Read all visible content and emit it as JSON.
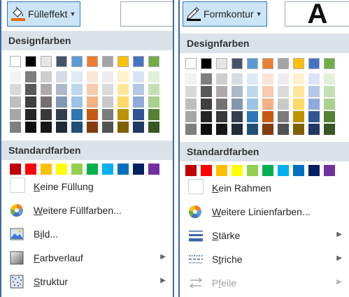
{
  "fill_menu": {
    "button_label": "Fülleffekt",
    "button_accent": "#e46c0a",
    "section_theme": "Designfarben",
    "section_standard": "Standardfarben",
    "items": [
      {
        "pre": "",
        "u": "K",
        "post": "eine Füllung",
        "icon": "no-fill-icon",
        "submenu": false,
        "disabled": false
      },
      {
        "pre": "",
        "u": "W",
        "post": "eitere Füllfarben...",
        "icon": "color-wheel-icon",
        "submenu": false,
        "disabled": false
      },
      {
        "pre": "B",
        "u": "i",
        "post": "ld...",
        "icon": "picture-icon",
        "submenu": false,
        "disabled": false
      },
      {
        "pre": "",
        "u": "F",
        "post": "arbverlauf",
        "icon": "gradient-icon",
        "submenu": true,
        "disabled": false
      },
      {
        "pre": "",
        "u": "S",
        "post": "truktur",
        "icon": "texture-icon",
        "submenu": true,
        "disabled": false
      }
    ]
  },
  "outline_menu": {
    "button_label": "Formkontur",
    "button_accent": "#000000",
    "big_letter": "A",
    "section_theme": "Designfarben",
    "section_standard": "Standardfarben",
    "items": [
      {
        "pre": "",
        "u": "K",
        "post": "ein Rahmen",
        "icon": "no-outline-icon",
        "submenu": false,
        "disabled": false
      },
      {
        "pre": "",
        "u": "W",
        "post": "eitere Linienfarben...",
        "icon": "color-wheel-icon",
        "submenu": false,
        "disabled": false
      },
      {
        "pre": "",
        "u": "S",
        "post": "tärke",
        "icon": "line-weight-icon",
        "submenu": true,
        "disabled": false
      },
      {
        "pre": "S",
        "u": "t",
        "post": "riche",
        "icon": "dashes-icon",
        "submenu": true,
        "disabled": false
      },
      {
        "pre": "P",
        "u": "f",
        "post": "eile",
        "icon": "arrows-icon",
        "submenu": true,
        "disabled": true
      }
    ]
  },
  "theme_colors": [
    [
      "#ffffff",
      "#f2f2f2",
      "#d9d9d9",
      "#bfbfbf",
      "#a6a6a6",
      "#7f7f7f"
    ],
    [
      "#000000",
      "#7f7f7f",
      "#595959",
      "#3f3f3f",
      "#262626",
      "#0d0d0d"
    ],
    [
      "#e7e6e6",
      "#d0cece",
      "#aeaaaa",
      "#757171",
      "#3a3838",
      "#171616"
    ],
    [
      "#44546a",
      "#d6dce5",
      "#adb9ca",
      "#8497b0",
      "#333f50",
      "#222a35"
    ],
    [
      "#5b9bd5",
      "#deebf7",
      "#bdd7ee",
      "#9dc3e6",
      "#2e75b6",
      "#1f4e79"
    ],
    [
      "#ed7d31",
      "#fbe5d6",
      "#f8cbad",
      "#f4b183",
      "#c55a11",
      "#843c0c"
    ],
    [
      "#a5a5a5",
      "#ededed",
      "#dbdbdb",
      "#c9c9c9",
      "#7b7b7b",
      "#525252"
    ],
    [
      "#ffc000",
      "#fff2cc",
      "#ffe699",
      "#ffd966",
      "#bf9000",
      "#7f6000"
    ],
    [
      "#4472c4",
      "#dae3f3",
      "#b4c7e7",
      "#8faadc",
      "#2f5597",
      "#203864"
    ],
    [
      "#70ad47",
      "#e2f0d9",
      "#c5e0b4",
      "#a9d18e",
      "#548235",
      "#385723"
    ]
  ],
  "standard_colors": [
    "#c00000",
    "#ff0000",
    "#ffc000",
    "#ffff00",
    "#92d050",
    "#00b050",
    "#00b0f0",
    "#0070c0",
    "#002060",
    "#7030a0"
  ],
  "chrome_colors": {
    "header_bg": "#dbe2ea",
    "pane_border": "#3f68a6",
    "button_bg": "#cce4f7"
  }
}
